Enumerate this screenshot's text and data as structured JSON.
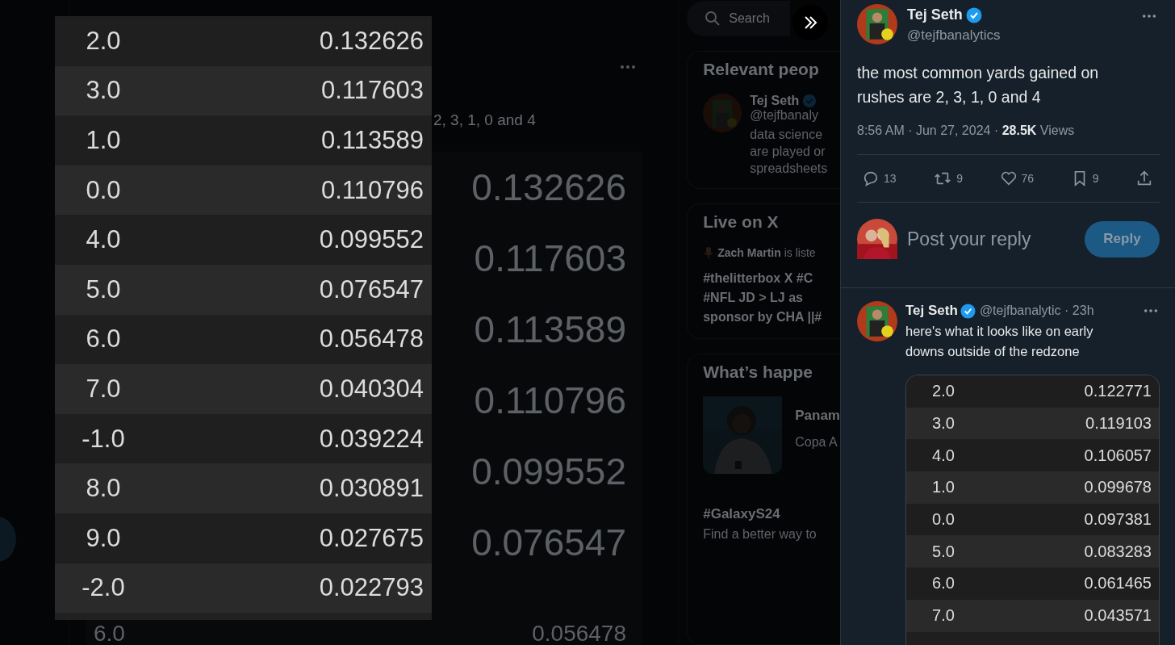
{
  "background_page": {
    "post_excerpt": "2, 3, 1, 0 and 4",
    "image_values": [
      "0.132626",
      "0.117603",
      "0.113589",
      "0.110796",
      "0.099552",
      "0.076547",
      "0.056478"
    ],
    "image_last_label": "6.0",
    "sidebar": {
      "search": {
        "placeholder": "Search"
      },
      "relevant_people": {
        "title": "Relevant peop",
        "name": "Tej Seth",
        "verified": true,
        "handle": "@tejfbanaly",
        "bio_lines": [
          "data science",
          "are played or",
          "spreadsheets"
        ]
      },
      "live": {
        "title": "Live on X",
        "listener": "**Zach Martin** is liste",
        "topic_lines": [
          "#thelitterbox X #C",
          "#NFL JD > LJ as",
          "sponsor by CHA ||#"
        ]
      },
      "trends": {
        "title": "What’s happe",
        "items": [
          {
            "kind": "picture",
            "title": "Panam",
            "subtitle": "Copa A"
          },
          {
            "kind": "text",
            "title": "#GalaxyS24",
            "subtitle": "Find a better way to"
          }
        ]
      }
    }
  },
  "media_viewer": {
    "rows": [
      {
        "label": "2.0",
        "value": "0.132626"
      },
      {
        "label": "3.0",
        "value": "0.117603"
      },
      {
        "label": "1.0",
        "value": "0.113589"
      },
      {
        "label": "0.0",
        "value": "0.110796"
      },
      {
        "label": "4.0",
        "value": "0.099552"
      },
      {
        "label": "5.0",
        "value": "0.076547"
      },
      {
        "label": "6.0",
        "value": "0.056478"
      },
      {
        "label": "7.0",
        "value": "0.040304"
      },
      {
        "label": "-1.0",
        "value": "0.039224"
      },
      {
        "label": "8.0",
        "value": "0.030891"
      },
      {
        "label": "9.0",
        "value": "0.027675"
      },
      {
        "label": "-2.0",
        "value": "0.022793"
      }
    ]
  },
  "post": {
    "author": {
      "name": "Tej Seth",
      "handle": "@tejfbanalytics",
      "verified": true
    },
    "text": "the most common yards gained on rushes are 2, 3, 1, 0 and 4",
    "meta": "8:56 AM · Jun 27, 2024 · **28.5K** Views",
    "actions": [
      {
        "kind": "reply",
        "count": "13"
      },
      {
        "kind": "repost",
        "count": "9"
      },
      {
        "kind": "like",
        "count": "76"
      },
      {
        "kind": "bookmark",
        "count": "9"
      },
      {
        "kind": "share"
      }
    ]
  },
  "composer": {
    "placeholder": "Post your reply",
    "button": "Reply",
    "disabled": true
  },
  "reply": {
    "author": {
      "name": "Tej Seth",
      "verified": true
    },
    "handle_time": "@tejfbanalytic · 23h",
    "text": "here's what it looks like on early downs outside of the redzone",
    "rows": [
      {
        "label": "2.0",
        "value": "0.122771"
      },
      {
        "label": "3.0",
        "value": "0.119103"
      },
      {
        "label": "4.0",
        "value": "0.106057"
      },
      {
        "label": "1.0",
        "value": "0.099678"
      },
      {
        "label": "0.0",
        "value": "0.097381"
      },
      {
        "label": "5.0",
        "value": "0.083283"
      },
      {
        "label": "6.0",
        "value": "0.061465"
      },
      {
        "label": "7.0",
        "value": "0.043571"
      }
    ]
  }
}
